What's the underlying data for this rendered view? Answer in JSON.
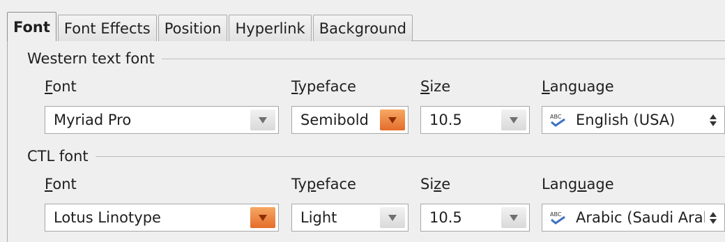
{
  "tabs": [
    {
      "label": "Font",
      "active": true
    },
    {
      "label": "Font Effects",
      "active": false
    },
    {
      "label": "Position",
      "active": false
    },
    {
      "label": "Hyperlink",
      "active": false
    },
    {
      "label": "Background",
      "active": false
    }
  ],
  "western": {
    "title": "Western text font",
    "font_label": "Font",
    "typeface_label": "Typeface",
    "size_label": "Size",
    "language_label": "Language",
    "font_value": "Myriad Pro",
    "typeface_value": "Semibold",
    "size_value": "10.5",
    "language_value": "English (USA)"
  },
  "ctl": {
    "title": "CTL font",
    "font_label": "Font",
    "typeface_label": "Typeface",
    "size_label": "Size",
    "language_label": "Language",
    "font_value": "Lotus Linotype",
    "typeface_value": "Light",
    "size_value": "10.5",
    "language_value": "Arabic (Saudi Arabia)"
  },
  "colors": {
    "hot_button": "#e46c2a",
    "background": "#efefef",
    "spell_icon": "#3a6fc4"
  },
  "icons": {
    "dropdown": "triangle-down-icon",
    "language": "spellcheck-abc-icon",
    "spin": "up-down-arrows-icon"
  }
}
